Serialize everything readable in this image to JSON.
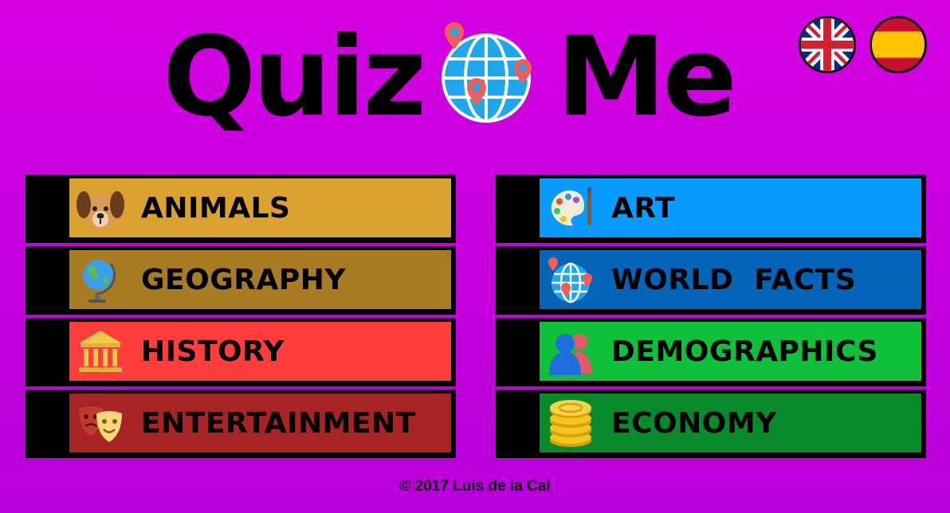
{
  "header": {
    "title_left": "Quiz",
    "title_right": "Me",
    "logo_icon": "globe-with-pins-icon"
  },
  "languages": [
    {
      "name": "english",
      "icon": "uk-flag-icon"
    },
    {
      "name": "spanish",
      "icon": "spain-flag-icon"
    }
  ],
  "categories": {
    "left": [
      {
        "label": "ANIMALS",
        "color": "#dba22f",
        "icon": "dog-icon"
      },
      {
        "label": "GEOGRAPHY",
        "color": "#a87b25",
        "icon": "desk-globe-icon"
      },
      {
        "label": "HISTORY",
        "color": "#ff3d3d",
        "icon": "museum-icon"
      },
      {
        "label": "ENTERTAINMENT",
        "color": "#a82323",
        "icon": "theater-masks-icon"
      }
    ],
    "right": [
      {
        "label": "ART",
        "color": "#0a9bff",
        "icon": "palette-icon"
      },
      {
        "label": "WORLD  FACTS",
        "color": "#0564b5",
        "icon": "globe-pins-icon"
      },
      {
        "label": "DEMOGRAPHICS",
        "color": "#0fc03a",
        "icon": "people-icon"
      },
      {
        "label": "ECONOMY",
        "color": "#088a2c",
        "icon": "coins-icon"
      }
    ]
  },
  "footer": {
    "copyright": "© 2017 Luis de la Cal"
  }
}
